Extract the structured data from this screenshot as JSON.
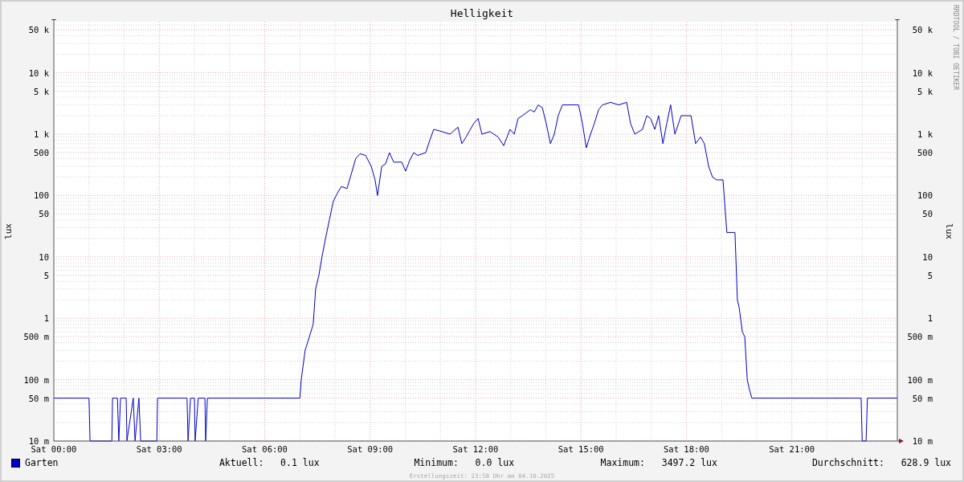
{
  "title": "Helligkeit",
  "branding": "RRDTOOL / TOBI OETIKER",
  "left_axis": {
    "label": "lux",
    "ticks": [
      "50 k",
      "10 k",
      "5 k",
      "1 k",
      "500",
      "100",
      "50",
      "10",
      "5",
      "1",
      "500 m",
      "100 m",
      "50 m",
      "10 m"
    ]
  },
  "right_axis": {
    "label": "lux",
    "ticks": [
      "50 k",
      "10 k",
      "5 k",
      "1 k",
      "500",
      "100",
      "50",
      "10",
      "5",
      "1",
      "500 m",
      "100 m",
      "50 m",
      "10 m"
    ]
  },
  "x_axis": {
    "ticks": [
      "Sat 00:00",
      "Sat 03:00",
      "Sat 06:00",
      "Sat 09:00",
      "Sat 12:00",
      "Sat 15:00",
      "Sat 18:00",
      "Sat 21:00"
    ]
  },
  "legend": {
    "name": "Garten",
    "color": "#0000cc",
    "stats": [
      {
        "label": "Aktuell:",
        "value": "0.1 lux"
      },
      {
        "label": "Minimum:",
        "value": "0.0 lux"
      },
      {
        "label": "Maximum:",
        "value": "3497.2 lux"
      },
      {
        "label": "Durchschnitt:",
        "value": "628.9 lux"
      }
    ]
  },
  "footer": "Erstellungszeit: 23:58 Uhr am 04.10.2025"
}
